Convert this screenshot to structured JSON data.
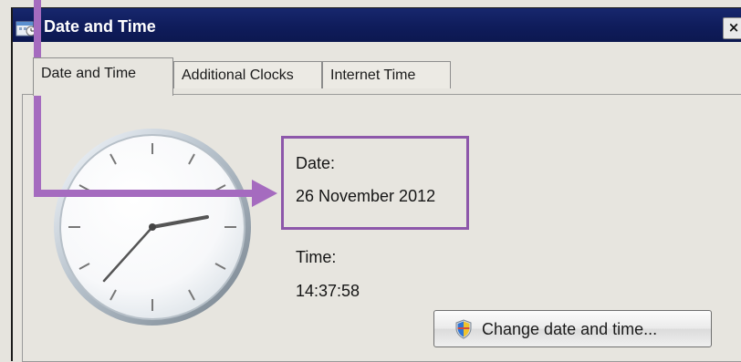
{
  "window": {
    "title": "Date and Time",
    "close_label": "×"
  },
  "tabs": [
    {
      "label": "Date and Time",
      "active": true
    },
    {
      "label": "Additional Clocks",
      "active": false
    },
    {
      "label": "Internet Time",
      "active": false
    }
  ],
  "content": {
    "date_label": "Date:",
    "date_value": "26 November 2012",
    "time_label": "Time:",
    "time_value": "14:37:58",
    "change_button_label": "Change date and time..."
  },
  "icons": {
    "app": "date-time-app-icon",
    "clock": "analog-clock-icon",
    "shield": "uac-shield-icon",
    "close": "close-icon"
  },
  "colors": {
    "titlebar": "#17276d",
    "highlight": "#8d57aa",
    "background": "#e7e5df"
  }
}
